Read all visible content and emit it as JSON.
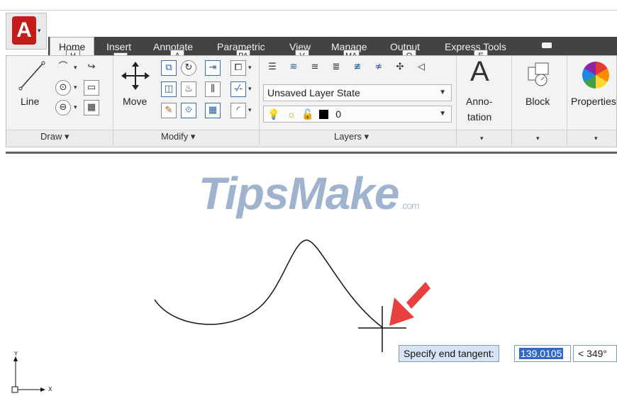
{
  "app": {
    "logo_letter": "A",
    "menu_arrow": "▾"
  },
  "tabs": [
    {
      "label": "Home",
      "keytip": "H"
    },
    {
      "label": "Insert",
      "keytip": "IN"
    },
    {
      "label": "Annotate",
      "keytip": "A"
    },
    {
      "label": "Parametric",
      "keytip": "PA"
    },
    {
      "label": "View",
      "keytip": "V"
    },
    {
      "label": "Manage",
      "keytip": "MA"
    },
    {
      "label": "Output",
      "keytip": "O"
    },
    {
      "label": "Express Tools",
      "keytip": "E"
    }
  ],
  "ribbon": {
    "draw": {
      "title": "Draw ▾",
      "line_label": "Line"
    },
    "modify": {
      "title": "Modify ▾",
      "move_label": "Move"
    },
    "layers": {
      "title": "Layers ▾",
      "layer_state": "Unsaved Layer State",
      "current_layer": "0"
    },
    "annotation": {
      "label_line1": "Anno-",
      "label_line2": "tation"
    },
    "block": {
      "label": "Block"
    },
    "properties": {
      "label": "Properties"
    },
    "panel_arrow": "▾"
  },
  "watermark": {
    "text": "TipsMake",
    "suffix": ".com"
  },
  "command": {
    "prompt": "Specify end tangent:",
    "length_value": "139.0105",
    "angle_value": "< 349°"
  },
  "ucs": {
    "y_label": "Y",
    "x_label": "X"
  },
  "colors": {
    "tab_bar": "#434343",
    "ribbon": "#f3f3f3",
    "logo_red": "#c51b1b",
    "arrow_red": "#e8403f",
    "selection_blue": "#3169c6"
  }
}
